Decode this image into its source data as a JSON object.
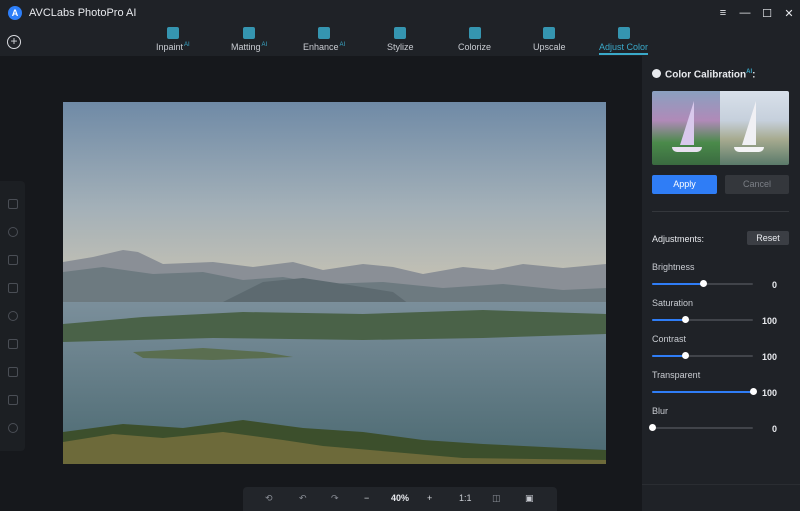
{
  "app": {
    "title": "AVCLabs PhotoPro AI",
    "logo_letter": "A"
  },
  "window_controls": {
    "menu": "≡",
    "minimize": "—",
    "maximize": "☐",
    "close": "✕"
  },
  "tabs": [
    {
      "label": "Inpaint",
      "ai": "AI"
    },
    {
      "label": "Matting",
      "ai": "AI"
    },
    {
      "label": "Enhance",
      "ai": "AI"
    },
    {
      "label": "Stylize",
      "ai": ""
    },
    {
      "label": "Colorize",
      "ai": ""
    },
    {
      "label": "Upscale",
      "ai": ""
    },
    {
      "label": "Adjust Color",
      "ai": ""
    }
  ],
  "active_tab": "Adjust Color",
  "bottom_bar": {
    "zoom": "40%",
    "minus": "−",
    "plus": "+",
    "ratio": "1:1"
  },
  "panel": {
    "title": "Color Calibration",
    "title_ai": "AI",
    "title_suffix": ":",
    "apply": "Apply",
    "cancel": "Cancel",
    "adjustments_label": "Adjustments:",
    "reset": "Reset",
    "sliders": [
      {
        "label": "Brightness",
        "value": "0",
        "fraction": 0.5
      },
      {
        "label": "Saturation",
        "value": "100",
        "fraction": 0.33
      },
      {
        "label": "Contrast",
        "value": "100",
        "fraction": 0.33
      },
      {
        "label": "Transparent",
        "value": "100",
        "fraction": 1.0
      },
      {
        "label": "Blur",
        "value": "0",
        "fraction": 0.0
      }
    ]
  },
  "colors": {
    "accent": "#3aa9c9",
    "primary_button": "#2f7df6",
    "background": "#16181c",
    "panel": "#1f2227"
  }
}
